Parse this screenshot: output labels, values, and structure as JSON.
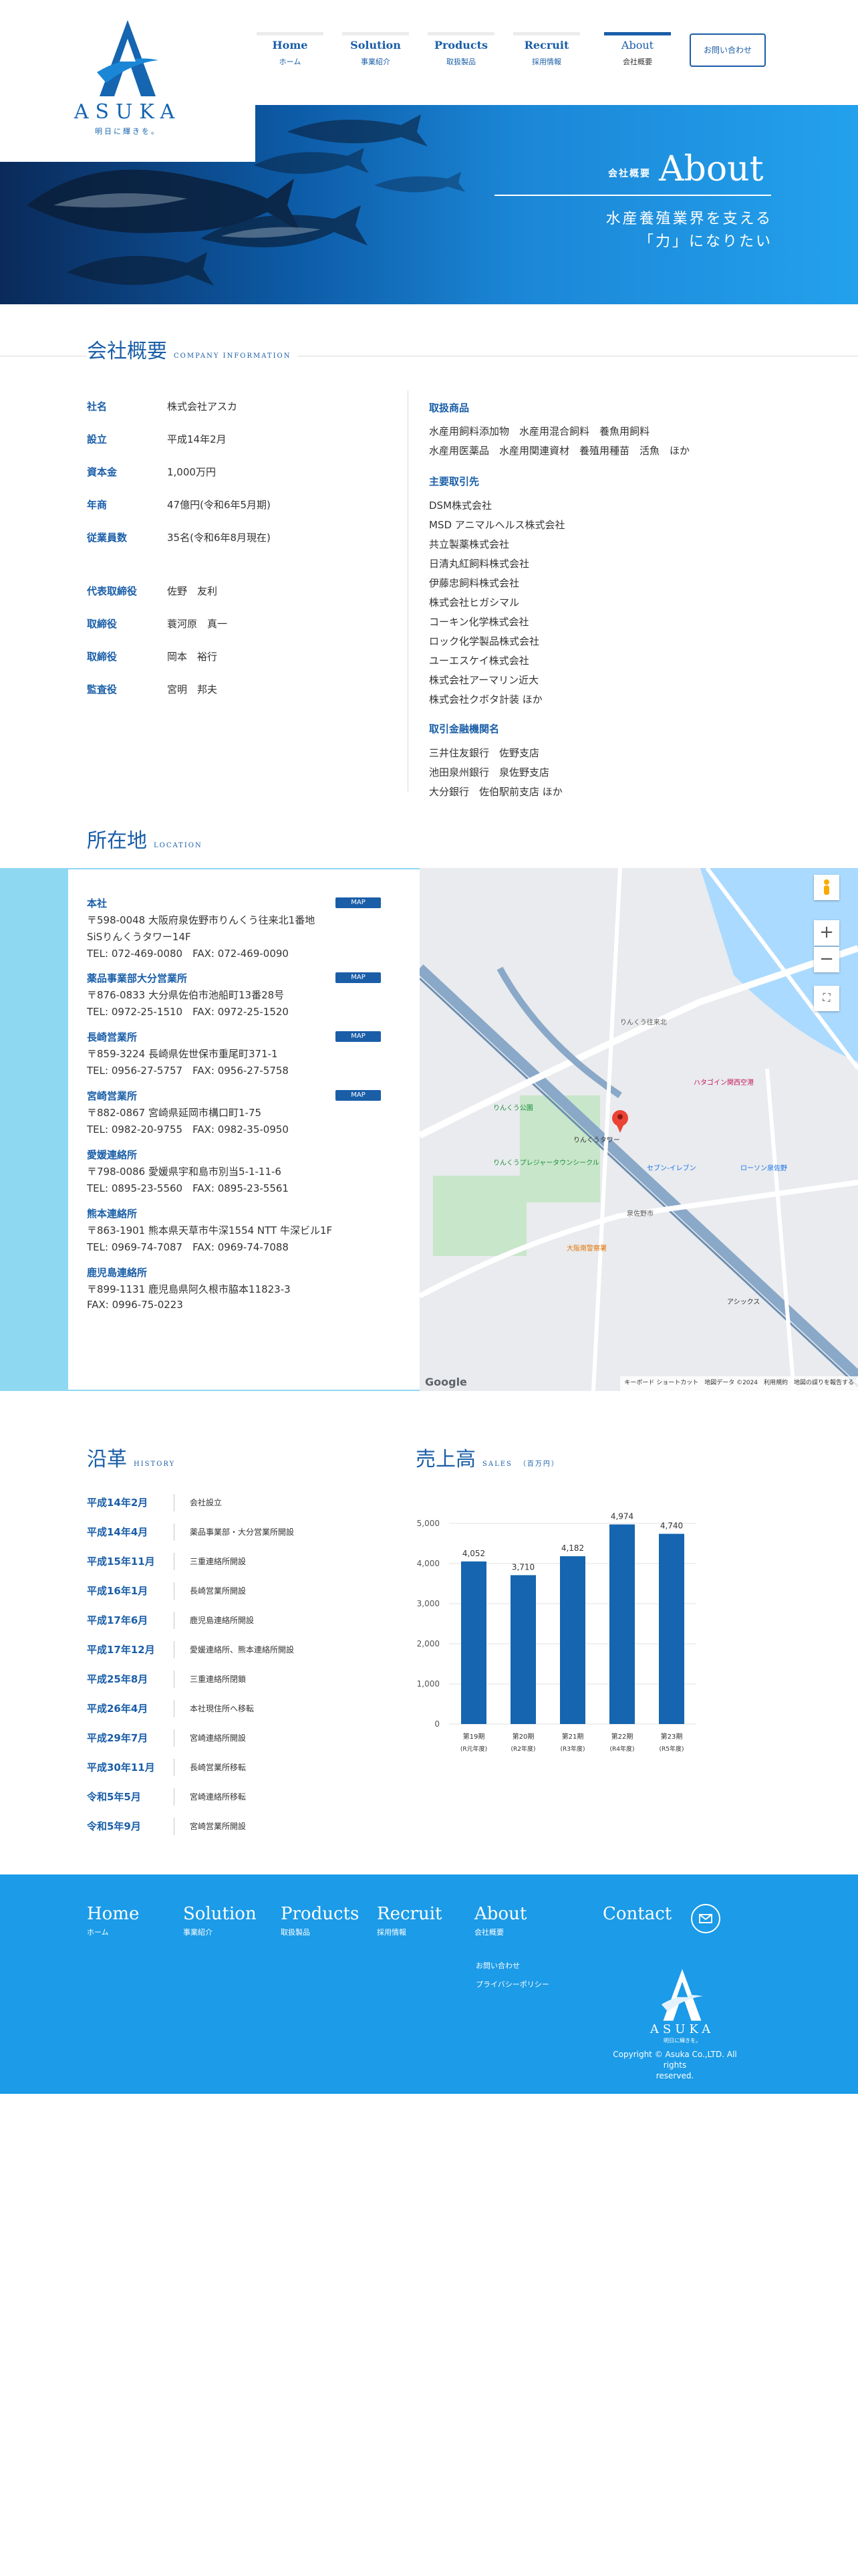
{
  "brand": {
    "logo_text": "ASUKA",
    "logo_sub": "明日に輝きを。",
    "primary_color": "#1a5ea8",
    "accent_color": "#1b9be8"
  },
  "nav": {
    "items": [
      {
        "en": "Home",
        "jp": "ホーム"
      },
      {
        "en": "Solution",
        "jp": "事業紹介"
      },
      {
        "en": "Products",
        "jp": "取扱製品"
      },
      {
        "en": "Recruit",
        "jp": "採用情報"
      },
      {
        "en": "About",
        "jp": "会社概要"
      }
    ],
    "active": "About",
    "contact_label": "お問い合わせ"
  },
  "hero": {
    "label": "会社概要",
    "title": "About",
    "copy_line1": "水産養殖業界を支える",
    "copy_line2": "「力」になりたい"
  },
  "overview": {
    "heading": "会社概要",
    "heading_en": "COMPANY INFORMATION",
    "rows": [
      {
        "label": "社名",
        "value": "株式会社アスカ"
      },
      {
        "label": "設立",
        "value": "平成14年2月"
      },
      {
        "label": "資本金",
        "value": "1,000万円"
      },
      {
        "label": "年商",
        "value": "47億円(令和6年5月期)"
      },
      {
        "label": "従業員数",
        "value": "35名(令和6年8月現在)"
      },
      {
        "label": "代表取締役",
        "value": "佐野　友利"
      },
      {
        "label": "取締役",
        "value": "蓑河原　真一"
      },
      {
        "label": "取締役",
        "value": "岡本　裕行"
      },
      {
        "label": "監査役",
        "value": "宮明　邦夫"
      }
    ],
    "products_heading": "取扱商品",
    "products_lines": [
      "水産用飼料添加物　水産用混合飼料　養魚用飼料",
      "水産用医薬品　水産用関連資材　養殖用種苗　活魚　ほか"
    ],
    "clients_heading": "主要取引先",
    "clients": [
      "DSM株式会社",
      "MSD アニマルヘルス株式会社",
      "共立製薬株式会社",
      "日清丸紅飼料株式会社",
      "伊藤忠飼料株式会社",
      "株式会社ヒガシマル",
      "コーキン化学株式会社",
      "ロック化学製品株式会社",
      "ユーエスケイ株式会社",
      "株式会社アーマリン近大",
      "株式会社クボタ計装 ほか"
    ],
    "banks_heading": "取引金融機関名",
    "banks": [
      "三井住友銀行　佐野支店",
      "池田泉州銀行　泉佐野支店",
      "大分銀行　佐伯駅前支店 ほか"
    ]
  },
  "location": {
    "heading": "所在地",
    "heading_en": "LOCATION",
    "map_label": "MAP",
    "offices": [
      {
        "name": "本社",
        "lines": [
          "〒598-0048 大阪府泉佐野市りんくう往来北1番地",
          "SiSりんくうタワー14F",
          "TEL: 072-469-0080　FAX: 072-469-0090"
        ],
        "map": true
      },
      {
        "name": "薬品事業部大分営業所",
        "lines": [
          "〒876-0833 大分県佐伯市池船町13番28号",
          "TEL: 0972-25-1510　FAX: 0972-25-1520"
        ],
        "map": true
      },
      {
        "name": "長崎営業所",
        "lines": [
          "〒859-3224 長崎県佐世保市重尾町371-1",
          "TEL: 0956-27-5757　FAX: 0956-27-5758"
        ],
        "map": true
      },
      {
        "name": "宮崎営業所",
        "lines": [
          "〒882-0867 宮崎県延岡市構口町1-75",
          "TEL: 0982-20-9755　FAX: 0982-35-0950"
        ],
        "map": true
      },
      {
        "name": "愛媛連絡所",
        "lines": [
          "〒798-0086 愛媛県宇和島市別当5-1-11-6",
          "TEL: 0895-23-5560　FAX: 0895-23-5561"
        ],
        "map": false
      },
      {
        "name": "熊本連絡所",
        "lines": [
          "〒863-1901 熊本県天草市牛深1554 NTT 牛深ビル1F",
          "TEL: 0969-74-7087　FAX: 0969-74-7088"
        ],
        "map": false
      },
      {
        "name": "鹿児島連絡所",
        "lines": [
          "〒899-1131 鹿児島県阿久根市脇本11823-3",
          "FAX: 0996-75-0223"
        ],
        "map": false
      }
    ],
    "map_attribution": "キーボード ショートカット　地図データ ©2024　利用規約　地図の誤りを報告する",
    "map_google": "Google",
    "map_labels": [
      "りんくう往来北",
      "りんくうタワー",
      "りんくう公園",
      "泉佐野市",
      "りんくうプレジャータウンシークル",
      "セブン-イレブン",
      "ハタゴイン関西空港",
      "ローソン泉佐野",
      "大阪南警察署",
      "アシックス"
    ]
  },
  "history": {
    "heading": "沿革",
    "heading_en": "HISTORY",
    "events": [
      {
        "date": "平成14年2月",
        "event": "会社設立"
      },
      {
        "date": "平成14年4月",
        "event": "薬品事業部・大分営業所開設"
      },
      {
        "date": "平成15年11月",
        "event": "三重連絡所開設"
      },
      {
        "date": "平成16年1月",
        "event": "長崎営業所開設"
      },
      {
        "date": "平成17年6月",
        "event": "鹿児島連絡所開設"
      },
      {
        "date": "平成17年12月",
        "event": "愛媛連絡所、熊本連絡所開設"
      },
      {
        "date": "平成25年8月",
        "event": "三重連絡所閉鎖"
      },
      {
        "date": "平成26年4月",
        "event": "本社現住所へ移転"
      },
      {
        "date": "平成29年7月",
        "event": "宮崎連絡所開設"
      },
      {
        "date": "平成30年11月",
        "event": "長崎営業所移転"
      },
      {
        "date": "令和5年5月",
        "event": "宮崎連絡所移転"
      },
      {
        "date": "令和5年9月",
        "event": "宮崎営業所開設"
      }
    ]
  },
  "sales": {
    "heading": "売上高",
    "heading_en": "SALES",
    "unit": "（百万円）"
  },
  "chart_data": {
    "type": "bar",
    "categories": [
      "第19期\n(R元年度)",
      "第20期\n(R2年度)",
      "第21期\n(R3年度)",
      "第22期\n(R4年度)",
      "第23期\n(R5年度)"
    ],
    "category_main": [
      "第19期",
      "第20期",
      "第21期",
      "第22期",
      "第23期"
    ],
    "category_sub": [
      "(R元年度)",
      "(R2年度)",
      "(R3年度)",
      "(R4年度)",
      "(R5年度)"
    ],
    "values": [
      4052,
      3710,
      4182,
      4974,
      4740
    ],
    "value_labels": [
      "4,052",
      "3,710",
      "4,182",
      "4,974",
      "4,740"
    ],
    "ylim": [
      0,
      5000
    ],
    "yticks": [
      0,
      1000,
      2000,
      3000,
      4000,
      5000
    ],
    "ytick_labels": [
      "0",
      "1,000",
      "2,000",
      "3,000",
      "4,000",
      "5,000"
    ],
    "grid": true,
    "bar_color": "#1565b0"
  },
  "footer": {
    "cols": [
      {
        "en": "Home",
        "jp": "ホーム"
      },
      {
        "en": "Solution",
        "jp": "事業紹介"
      },
      {
        "en": "Products",
        "jp": "取扱製品"
      },
      {
        "en": "Recruit",
        "jp": "採用情報"
      },
      {
        "en": "About",
        "jp": "会社概要"
      }
    ],
    "contact": "Contact",
    "link_contact": "お問い合わせ",
    "link_privacy": "プライバシーポリシー",
    "logo_text": "ASUKA",
    "logo_sub": "明日に輝きを。",
    "copyright_line1": "Copyright © Asuka Co.,LTD. All rights",
    "copyright_line2": "reserved."
  }
}
